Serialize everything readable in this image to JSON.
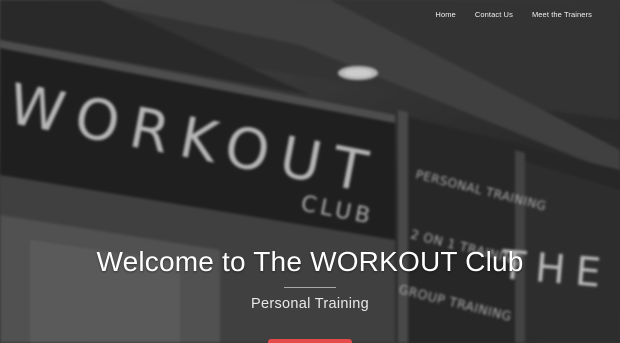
{
  "nav": {
    "items": [
      {
        "label": "Home"
      },
      {
        "label": "Contact Us"
      },
      {
        "label": "Meet the Trainers"
      }
    ]
  },
  "hero": {
    "title": "Welcome to The WORKOUT Club",
    "subtitle": "Personal Training",
    "sign_text": "WORKOUT",
    "sign_suffix": "CLUB",
    "window_lines": [
      "PERSONAL TRAINING",
      "2 ON 1 TRAINING",
      "GROUP TRAINING"
    ],
    "window_right": "THE W"
  },
  "colors": {
    "accent": "#e54b4b",
    "text": "#ffffff"
  }
}
